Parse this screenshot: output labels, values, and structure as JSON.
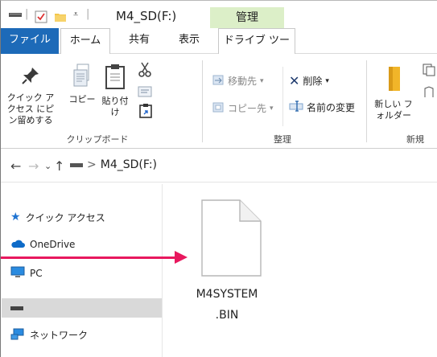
{
  "window": {
    "title": "M4_SD(F:)",
    "contextual_tab_group": "管理",
    "title_separator": "|"
  },
  "tabs": [
    {
      "label": "ファイル"
    },
    {
      "label": "ホーム"
    },
    {
      "label": "共有"
    },
    {
      "label": "表示"
    },
    {
      "label": "ドライブ ツール"
    }
  ],
  "ribbon": {
    "clipboard": {
      "pin_label": "クイック アクセス にピン留めする",
      "copy_label": "コピー",
      "paste_label": "貼り付け",
      "group_label": "クリップボード"
    },
    "organize": {
      "move_to": "移動先",
      "copy_to": "コピー先",
      "delete": "削除",
      "rename": "名前の変更",
      "group_label": "整理"
    },
    "new": {
      "new_folder": "新しい フォルダー",
      "group_label": "新規"
    }
  },
  "address": {
    "separator": ">",
    "location": "M4_SD(F:)"
  },
  "nav": {
    "quick_access": "クイック アクセス",
    "onedrive": "OneDrive",
    "pc": "PC",
    "network": "ネットワーク"
  },
  "file": {
    "name_line1": "M4SYSTEM",
    "name_line2": ".BIN"
  },
  "colors": {
    "file_tab": "#1d6ab8",
    "manage_tab": "#dcefc8",
    "arrow": "#e8185e",
    "nav_selected": "#d9d9d9"
  }
}
